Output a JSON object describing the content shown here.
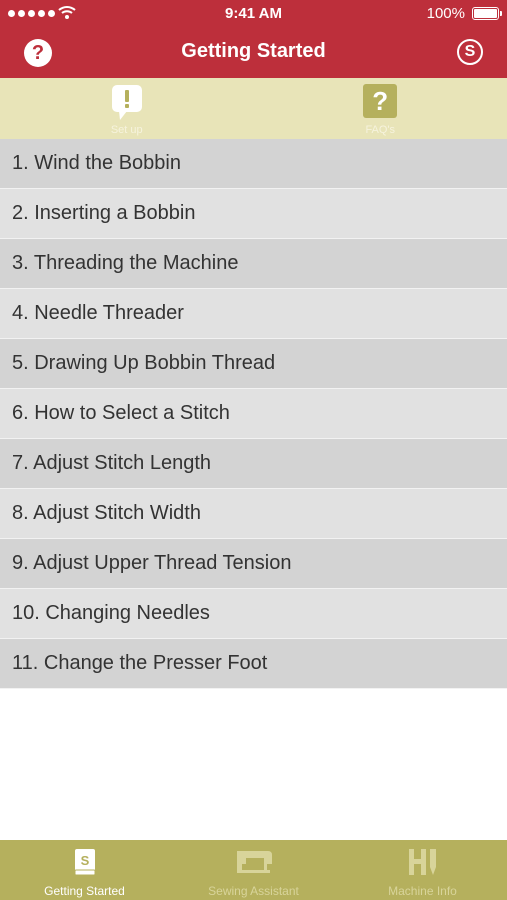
{
  "status": {
    "time": "9:41 AM",
    "battery": "100%"
  },
  "nav": {
    "title": "Getting Started",
    "help_glyph": "?",
    "right_glyph": "S"
  },
  "segments": [
    {
      "label": "Set up",
      "icon": "speech-bubble-exclamation-icon"
    },
    {
      "label": "FAQ's",
      "icon": "question-mark-icon",
      "glyph": "?"
    }
  ],
  "list": [
    {
      "label": "1. Wind the Bobbin"
    },
    {
      "label": "2. Inserting a Bobbin"
    },
    {
      "label": "3. Threading the Machine"
    },
    {
      "label": "4. Needle Threader"
    },
    {
      "label": "5. Drawing Up Bobbin Thread"
    },
    {
      "label": "6. How to Select a Stitch"
    },
    {
      "label": "7. Adjust Stitch Length"
    },
    {
      "label": "8. Adjust Stitch Width"
    },
    {
      "label": "9. Adjust Upper Thread Tension"
    },
    {
      "label": "10. Changing Needles"
    },
    {
      "label": "11. Change the Presser Foot"
    }
  ],
  "tabs": [
    {
      "label": "Getting Started",
      "icon": "book-icon",
      "glyph": "S",
      "active": true
    },
    {
      "label": "Sewing Assistant",
      "icon": "sewing-machine-icon",
      "active": false
    },
    {
      "label": "Machine Info",
      "icon": "machine-info-icon",
      "active": false
    }
  ],
  "colors": {
    "header": "#bd2f3b",
    "segment_bar": "#e8e4b8",
    "tab_bar": "#b5b05d",
    "row_odd": "#d3d3d3",
    "row_even": "#e1e1e1"
  }
}
